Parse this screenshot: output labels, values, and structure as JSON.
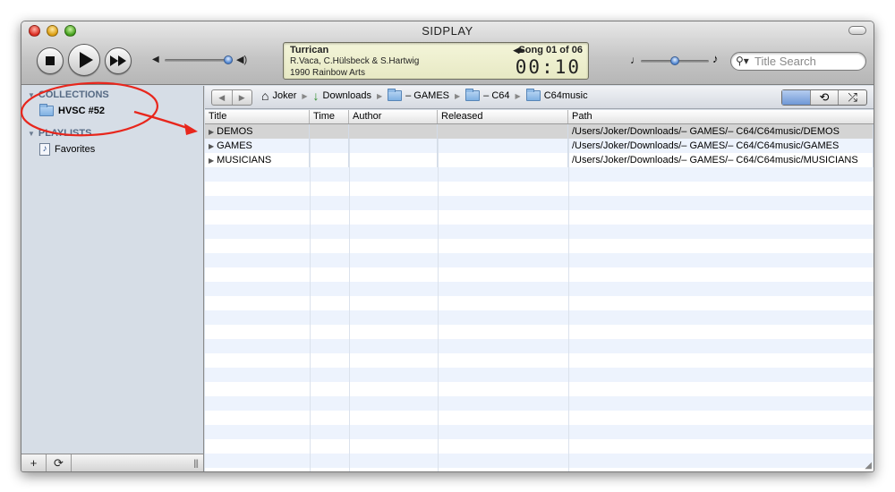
{
  "window": {
    "title": "SIDPLAY"
  },
  "player": {
    "tune_title": "Turrican",
    "tune_author": "R.Vaca, C.Hülsbeck & S.Hartwig",
    "tune_release": "1990 Rainbow Arts",
    "song_label": "Song 01 of 06",
    "time": "00:10"
  },
  "search": {
    "placeholder": "Title Search"
  },
  "sidebar": {
    "collections_header": "COLLECTIONS",
    "collections": [
      {
        "label": "HVSC #52"
      }
    ],
    "playlists_header": "PLAYLISTS",
    "playlists": [
      {
        "label": "Favorites"
      }
    ]
  },
  "breadcrumb": {
    "items": [
      {
        "label": "Joker",
        "icon": "home-icon"
      },
      {
        "label": "Downloads",
        "icon": "download-arrow-icon"
      },
      {
        "label": "– GAMES",
        "icon": "folder-icon"
      },
      {
        "label": "– C64",
        "icon": "folder-icon"
      },
      {
        "label": "C64music",
        "icon": "folder-icon"
      }
    ]
  },
  "table": {
    "columns": [
      "Title",
      "Time",
      "Author",
      "Released",
      "Path"
    ],
    "rows": [
      {
        "title": "DEMOS",
        "time": "",
        "author": "",
        "released": "",
        "path": "/Users/Joker/Downloads/– GAMES/– C64/C64music/DEMOS",
        "selected": true
      },
      {
        "title": "GAMES",
        "time": "",
        "author": "",
        "released": "",
        "path": "/Users/Joker/Downloads/– GAMES/– C64/C64music/GAMES",
        "selected": false
      },
      {
        "title": "MUSICIANS",
        "time": "",
        "author": "",
        "released": "",
        "path": "/Users/Joker/Downloads/– GAMES/– C64/C64music/MUSICIANS",
        "selected": false
      }
    ]
  },
  "colors": {
    "annotation_red": "#e8261c",
    "selection_gray": "#d4d4d4",
    "stripe_blue": "#edf3fd",
    "sidebar_bg": "#d6dde6",
    "sidebar_header": "#566a84"
  }
}
